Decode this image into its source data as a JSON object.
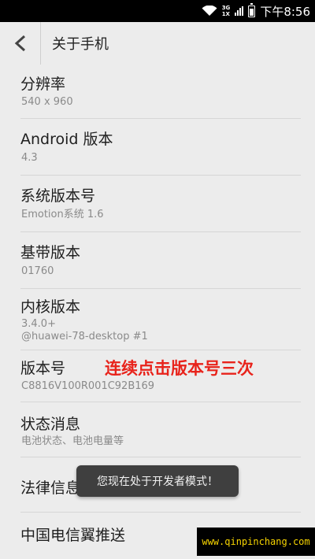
{
  "status_bar": {
    "network_top": "3G",
    "network_bottom": "1X",
    "time": "下午8:56"
  },
  "header": {
    "title": "关于手机"
  },
  "items": [
    {
      "label": "分辨率",
      "value": "540 x 960"
    },
    {
      "label": "Android 版本",
      "value": "4.3"
    },
    {
      "label": "系统版本号",
      "value": "Emotion系统 1.6"
    },
    {
      "label": "基带版本",
      "value": "01760"
    },
    {
      "label": "内核版本",
      "value_line1": "3.4.0+",
      "value_line2": "@huawei-78-desktop #1"
    },
    {
      "label": "版本号",
      "value": "C8816V100R001C92B169"
    },
    {
      "label": "状态消息",
      "value": "电池状态、电池电量等"
    },
    {
      "label": "法律信息"
    },
    {
      "label": "中国电信翼推送"
    }
  ],
  "annotation": "连续点击版本号三次",
  "toast": "您现在处于开发者模式！",
  "watermark": "www.qinpinchang.com",
  "colors": {
    "annotation": "#e8231b",
    "watermark": "#f7d400",
    "background": "#ececec"
  }
}
